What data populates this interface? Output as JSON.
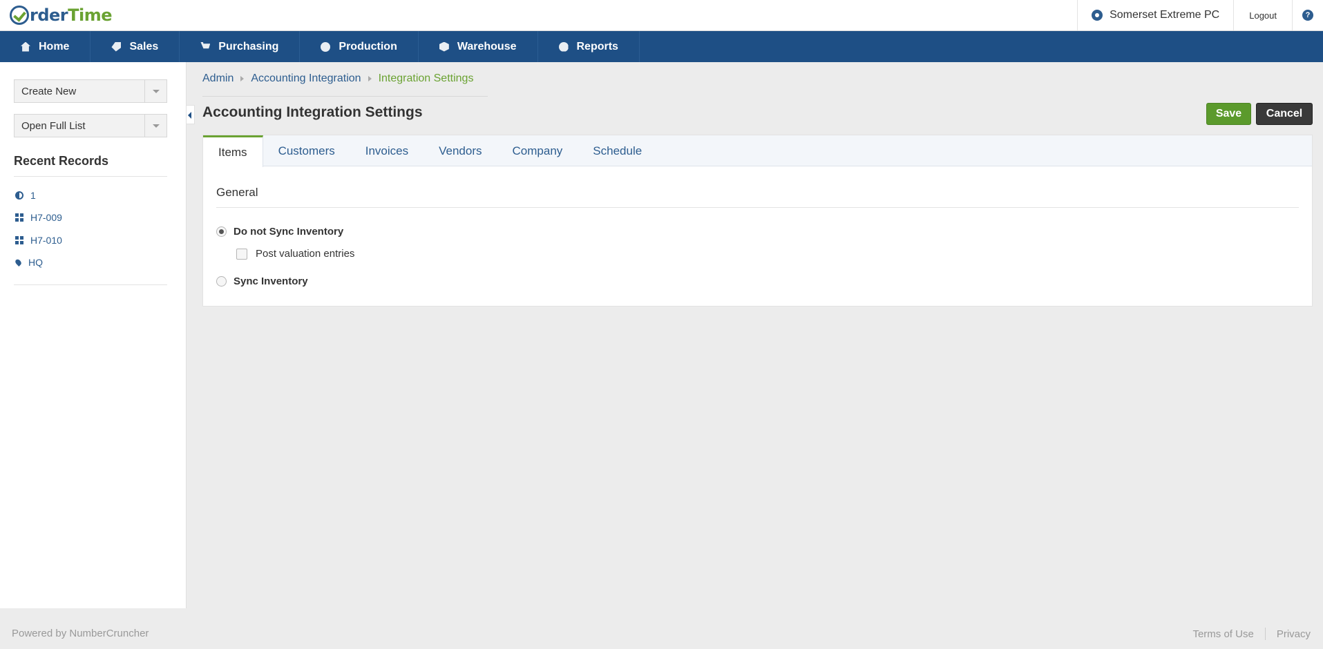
{
  "app": {
    "logo_text_1": "rder",
    "logo_text_2": "Time"
  },
  "topbar": {
    "company": "Somerset Extreme PC",
    "logout": "Logout",
    "help": "?"
  },
  "nav": {
    "items": [
      {
        "label": "Home",
        "icon": "home-icon"
      },
      {
        "label": "Sales",
        "icon": "tag-icon"
      },
      {
        "label": "Purchasing",
        "icon": "cart-icon"
      },
      {
        "label": "Production",
        "icon": "cogs-icon"
      },
      {
        "label": "Warehouse",
        "icon": "box-icon"
      },
      {
        "label": "Reports",
        "icon": "pie-chart-icon"
      }
    ]
  },
  "sidebar": {
    "create_new": "Create New",
    "open_full_list": "Open Full List",
    "recent_title": "Recent Records",
    "recent": [
      {
        "label": "1",
        "icon": "half-circle-icon"
      },
      {
        "label": "H7-009",
        "icon": "grid-icon"
      },
      {
        "label": "H7-010",
        "icon": "grid-icon"
      },
      {
        "label": "HQ",
        "icon": "map-pin-icon"
      }
    ]
  },
  "breadcrumb": {
    "items": [
      "Admin",
      "Accounting Integration",
      "Integration Settings"
    ]
  },
  "page": {
    "title": "Accounting Integration Settings",
    "save": "Save",
    "cancel": "Cancel"
  },
  "tabs": {
    "items": [
      "Items",
      "Customers",
      "Invoices",
      "Vendors",
      "Company",
      "Schedule"
    ],
    "active": "Items"
  },
  "general": {
    "title": "General",
    "option_no_sync": "Do not Sync Inventory",
    "post_valuation": "Post valuation entries",
    "option_sync": "Sync Inventory",
    "selected": "Do not Sync Inventory",
    "post_valuation_checked": false
  },
  "footer": {
    "powered": "Powered by NumberCruncher",
    "terms": "Terms of Use",
    "privacy": "Privacy"
  },
  "colors": {
    "nav_bg": "#1e4f85",
    "accent_green": "#6aa232",
    "link_blue": "#2d5d8f",
    "save_bg": "#5b9a2c",
    "cancel_bg": "#3a3a3a"
  }
}
